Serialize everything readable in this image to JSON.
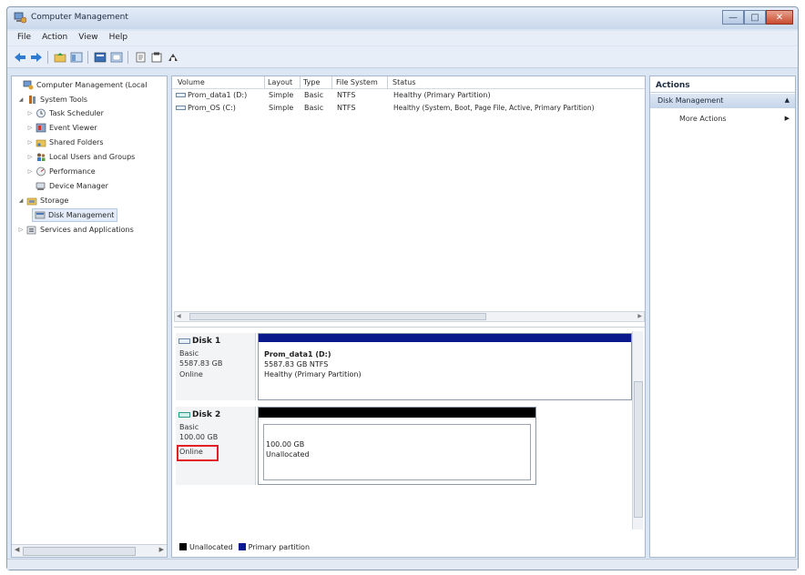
{
  "window": {
    "title": "Computer Management"
  },
  "menu": [
    "File",
    "Action",
    "View",
    "Help"
  ],
  "tree": {
    "root": "Computer Management (Local",
    "system_tools": "System Tools",
    "task_scheduler": "Task Scheduler",
    "event_viewer": "Event Viewer",
    "shared_folders": "Shared Folders",
    "local_users": "Local Users and Groups",
    "performance": "Performance",
    "device_manager": "Device Manager",
    "storage": "Storage",
    "disk_management": "Disk Management",
    "services": "Services and Applications"
  },
  "volume_list": {
    "columns": [
      "Volume",
      "Layout",
      "Type",
      "File System",
      "Status"
    ],
    "rows": [
      {
        "volume": "Prom_data1 (D:)",
        "layout": "Simple",
        "type": "Basic",
        "fs": "NTFS",
        "status": "Healthy (Primary Partition)"
      },
      {
        "volume": "Prom_OS (C:)",
        "layout": "Simple",
        "type": "Basic",
        "fs": "NTFS",
        "status": "Healthy (System, Boot, Page File, Active, Primary Partition)"
      }
    ]
  },
  "disks": [
    {
      "name": "Disk 1",
      "type": "Basic",
      "size": "5587.83 GB",
      "state": "Online",
      "partition": {
        "name": "Prom_data1 (D:)",
        "size_fs": "5587.83 GB NTFS",
        "status": "Healthy (Primary Partition)",
        "color": "#0a1a8c"
      }
    },
    {
      "name": "Disk 2",
      "type": "Basic",
      "size": "100.00 GB",
      "state": "Online",
      "partition": {
        "size": "100.00 GB",
        "status": "Unallocated",
        "color": "#000000"
      }
    }
  ],
  "legend": {
    "unallocated": "Unallocated",
    "primary": "Primary partition",
    "unallocated_color": "#000000",
    "primary_color": "#0a1a8c"
  },
  "actions": {
    "title": "Actions",
    "section": "Disk Management",
    "more": "More Actions"
  },
  "colors": {
    "highlight": "#e31e24",
    "primary_bar": "#0a1a8c"
  }
}
